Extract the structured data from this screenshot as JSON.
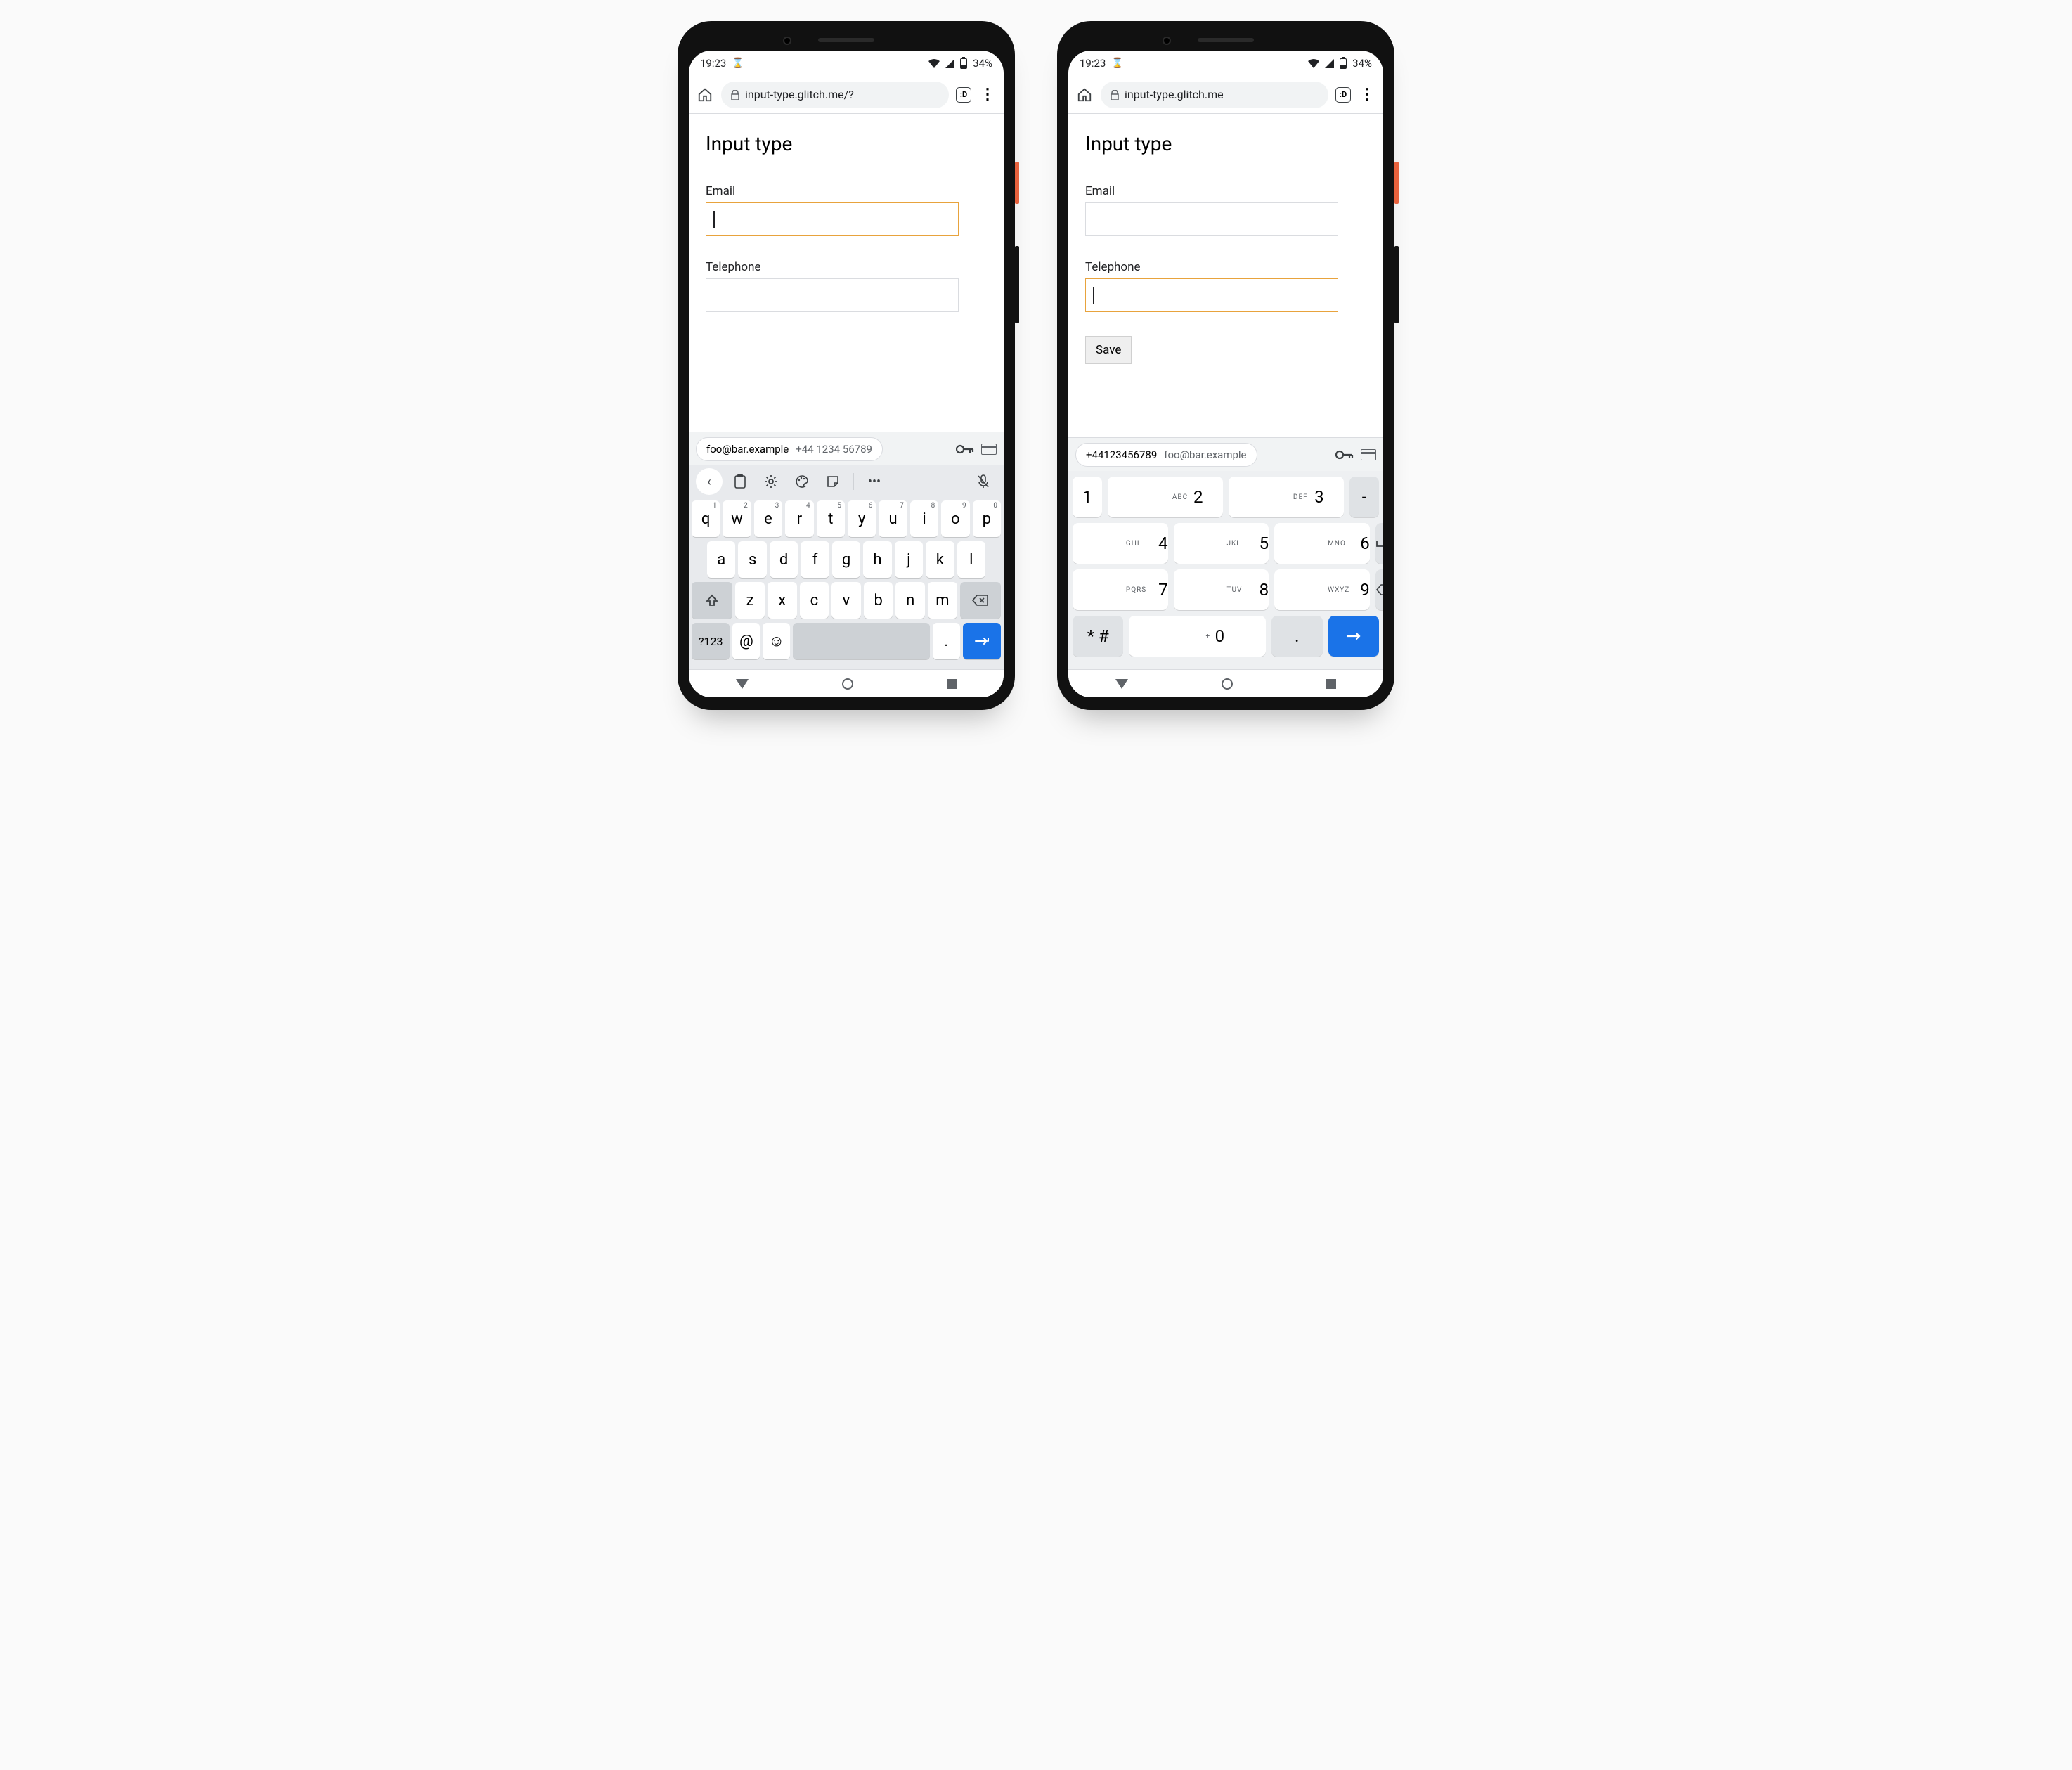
{
  "status": {
    "time": "19:23",
    "battery": "34%"
  },
  "omnibox": {
    "left_url": "input-type.glitch.me/?",
    "right_url": "input-type.glitch.me",
    "tab_icon_label": ":D"
  },
  "page": {
    "title": "Input type",
    "email_label": "Email",
    "telephone_label": "Telephone",
    "save_label": "Save"
  },
  "autofill": {
    "email": "foo@bar.example",
    "phone": "+44 1234 56789",
    "phone_compact": "+44123456789"
  },
  "qwerty": {
    "row1": [
      {
        "k": "q",
        "s": "1"
      },
      {
        "k": "w",
        "s": "2"
      },
      {
        "k": "e",
        "s": "3"
      },
      {
        "k": "r",
        "s": "4"
      },
      {
        "k": "t",
        "s": "5"
      },
      {
        "k": "y",
        "s": "6"
      },
      {
        "k": "u",
        "s": "7"
      },
      {
        "k": "i",
        "s": "8"
      },
      {
        "k": "o",
        "s": "9"
      },
      {
        "k": "p",
        "s": "0"
      }
    ],
    "row2": [
      "a",
      "s",
      "d",
      "f",
      "g",
      "h",
      "j",
      "k",
      "l"
    ],
    "row3": [
      "z",
      "x",
      "c",
      "v",
      "b",
      "n",
      "m"
    ],
    "sym_label": "?123",
    "at_label": "@",
    "period_label": "."
  },
  "numpad": {
    "rows": [
      [
        {
          "d": "1",
          "l": ""
        },
        {
          "d": "2",
          "l": "ABC"
        },
        {
          "d": "3",
          "l": "DEF"
        },
        {
          "d": "-",
          "l": "",
          "fn": true
        }
      ],
      [
        {
          "d": "4",
          "l": "GHI"
        },
        {
          "d": "5",
          "l": "JKL"
        },
        {
          "d": "6",
          "l": "MNO"
        },
        {
          "d": "␣",
          "l": "",
          "fn": true,
          "space": true
        }
      ],
      [
        {
          "d": "7",
          "l": "PQRS"
        },
        {
          "d": "8",
          "l": "TUV"
        },
        {
          "d": "9",
          "l": "WXYZ"
        },
        {
          "d": "⌫",
          "l": "",
          "fn": true,
          "bksp": true
        }
      ],
      [
        {
          "d": "* #",
          "l": "",
          "fn": true
        },
        {
          "d": "0",
          "l": "+"
        },
        {
          "d": ".",
          "l": "",
          "fn": true
        },
        {
          "d": "→",
          "l": "",
          "enter": true
        }
      ]
    ]
  }
}
